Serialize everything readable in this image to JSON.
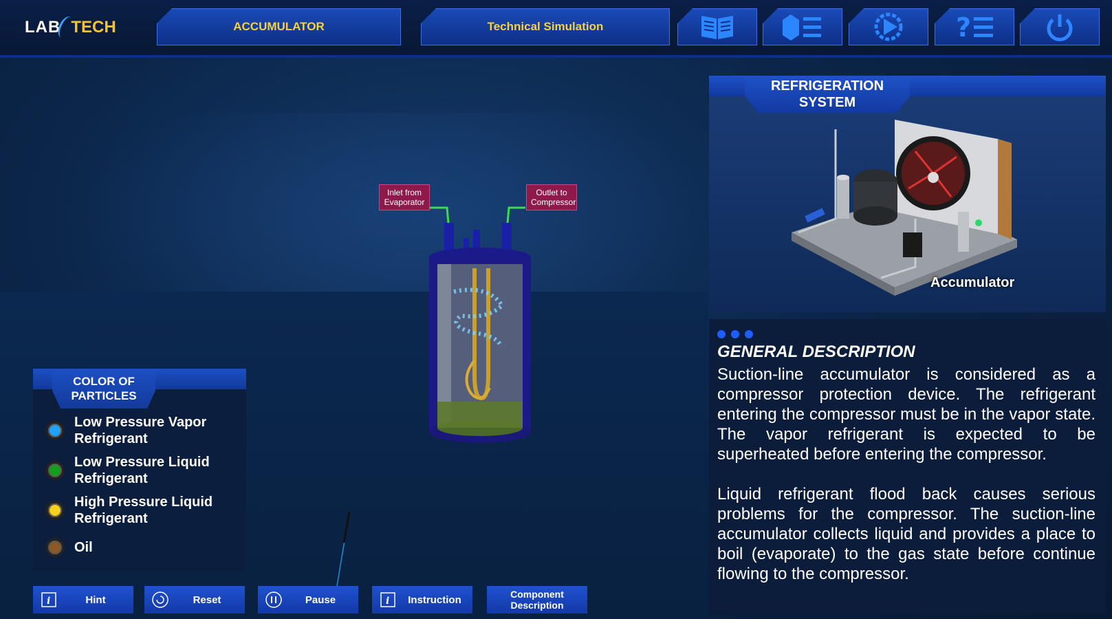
{
  "header": {
    "logo_lab": "LAB",
    "logo_tech": "TECH",
    "tab_module": "ACCUMULATOR",
    "tab_mode": "Technical Simulation",
    "icons": [
      "book-icon",
      "menu-list-icon",
      "play-settings-icon",
      "help-list-icon",
      "power-icon"
    ]
  },
  "scene": {
    "inlet_label": "Inlet from Evaporator",
    "outlet_label": "Outlet to Compressor"
  },
  "legend": {
    "title": "COLOR OF PARTICLES",
    "items": [
      {
        "label": "Low Pressure Vapor Refrigerant",
        "color": "#1ea3ff"
      },
      {
        "label": "Low Pressure Liquid Refrigerant",
        "color": "#14a01a"
      },
      {
        "label": "High Pressure Liquid Refrigerant",
        "color": "#f7d21a"
      },
      {
        "label": "Oil",
        "color": "#8a5a22"
      }
    ]
  },
  "bottom_buttons": {
    "hint": "Hint",
    "reset": "Reset",
    "pause": "Pause",
    "instruction": "Instruction",
    "component_description": "Component Description"
  },
  "system_panel": {
    "title": "REFRIGERATION SYSTEM",
    "caption": "Accumulator"
  },
  "description": {
    "title": "GENERAL DESCRIPTION",
    "paragraph1": "Suction-line accumulator is considered as a compressor protection device. The refrigerant entering the compressor must be in the vapor state. The vapor refrigerant is expected to be superheated before entering the compressor.",
    "paragraph2": "Liquid refrigerant flood back causes serious problems for the compressor. The suction-line accumulator collects liquid and provides a place to boil (evaporate) to the gas state before continue flowing to the compressor."
  },
  "colors": {
    "accent_blue": "#1f52d0",
    "tab_text": "#f6d23b",
    "label_tag": "#8e1a4c"
  }
}
